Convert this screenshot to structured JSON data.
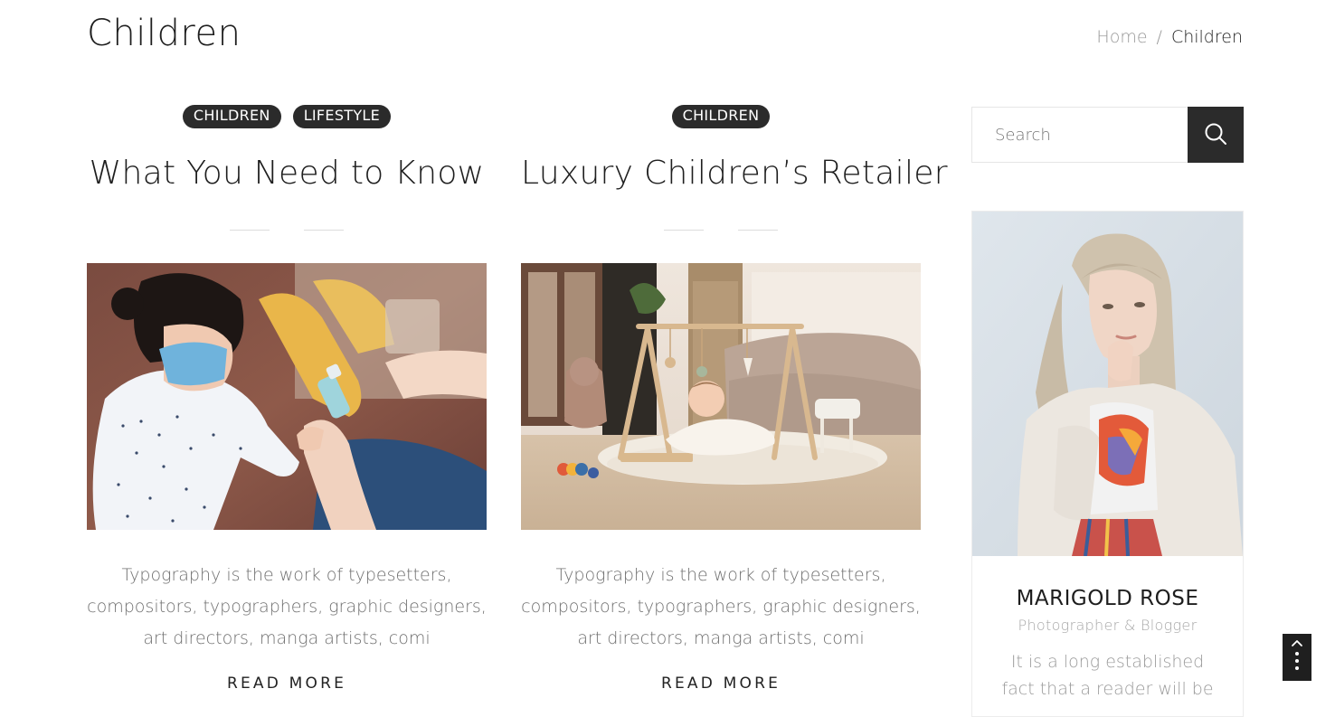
{
  "header": {
    "title": "Children",
    "breadcrumb": {
      "home": "Home",
      "separator": "/",
      "current": "Children"
    }
  },
  "posts": [
    {
      "categories": [
        "CHILDREN",
        "LIFESTYLE"
      ],
      "title": "What You Need to Know",
      "image": "child-with-mask-hand-sanitizer-photo",
      "excerpt": "Typography is the work of typesetters, compositors, typographers, graphic designers, art directors, manga artists, comi",
      "read_more": "READ MORE"
    },
    {
      "categories": [
        "CHILDREN"
      ],
      "title": "Luxury Children’s Retailer",
      "image": "baby-play-gym-nursery-photo",
      "excerpt": "Typography is the work of typesetters, compositors, typographers, graphic designers, art directors, manga artists, comi",
      "read_more": "READ MORE"
    }
  ],
  "sidebar": {
    "search": {
      "placeholder": "Search",
      "icon": "search-icon"
    },
    "author": {
      "name": "MARIGOLD ROSE",
      "role": "Photographer & Blogger",
      "bio": "It is a long established fact that a reader will be",
      "photo": "author-portrait-photo"
    }
  },
  "scroll_top": {
    "icon": "chevron-up-icon"
  },
  "colors": {
    "accent_dark": "#2b2b2b",
    "text_dark": "#1e1e1e",
    "text_muted": "#6f6f6f",
    "breadcrumb_muted": "#9a9a9a",
    "border": "#e6e6e6"
  }
}
